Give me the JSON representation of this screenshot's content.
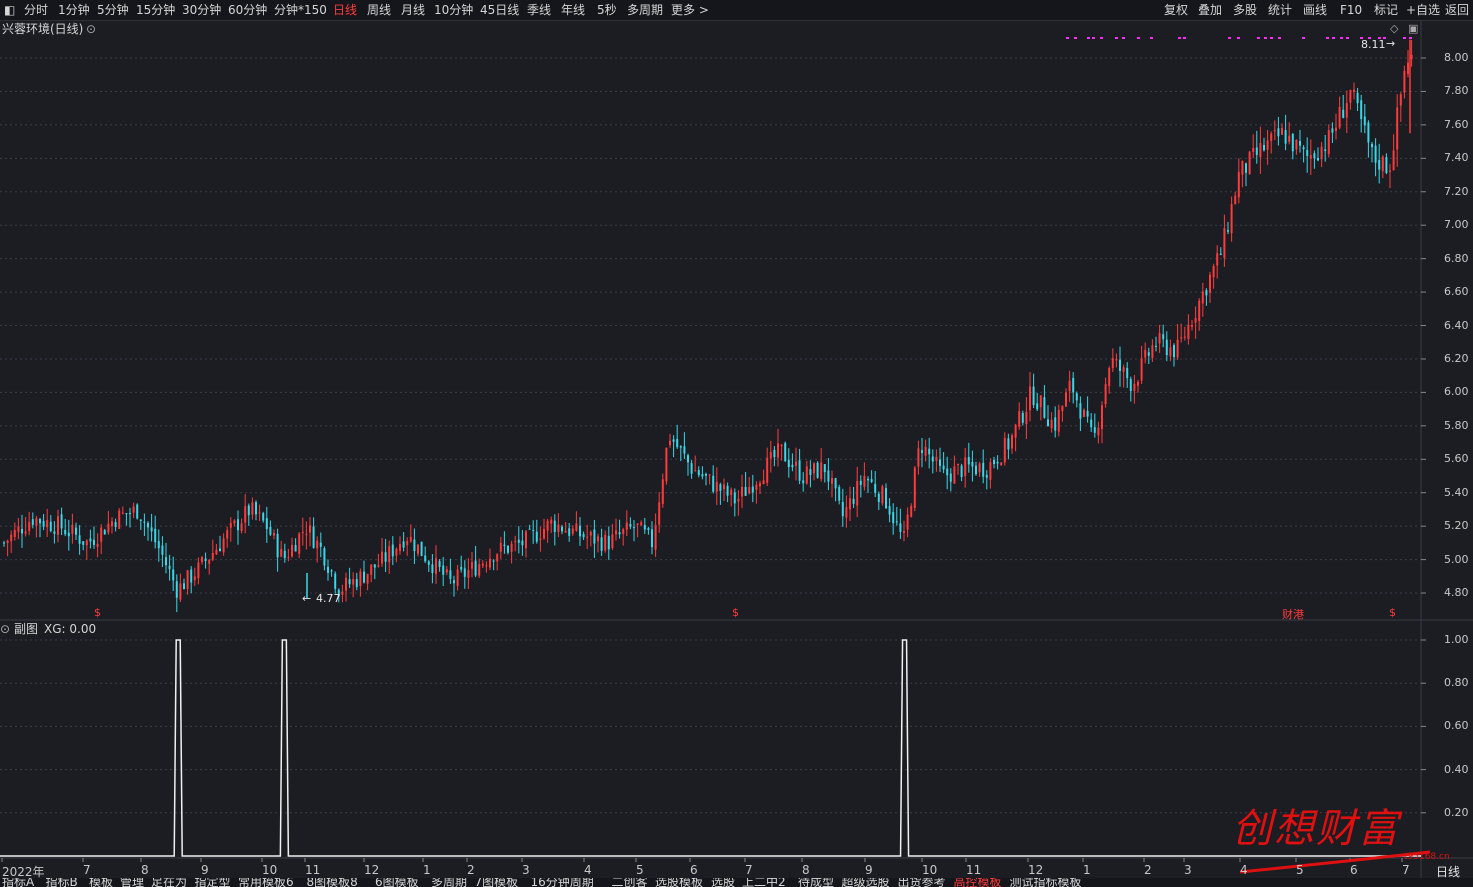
{
  "toolbar": {
    "left_items": [
      "分时",
      "1分钟",
      "5分钟",
      "15分钟",
      "30分钟",
      "60分钟",
      "分钟*150",
      "日线",
      "周线",
      "月线",
      "10分钟",
      "45日线",
      "季线",
      "年线",
      "5秒",
      "多周期",
      "更多 >"
    ],
    "active": "日线",
    "right_items": [
      "复权",
      "叠加",
      "多股",
      "统计",
      "画线",
      "F10",
      "标记",
      "+自选",
      "返回"
    ]
  },
  "main_chart": {
    "title": "兴蓉环境(日线)",
    "high_label": "8.11",
    "low_label": "4.77",
    "y_ticks": [
      "8.00",
      "7.80",
      "7.60",
      "7.40",
      "7.20",
      "7.00",
      "6.80",
      "6.60",
      "6.40",
      "6.20",
      "6.00",
      "5.80",
      "5.60",
      "5.40",
      "5.20",
      "5.00",
      "4.80"
    ],
    "event_marks": [
      "$",
      "$",
      "财港",
      "$"
    ]
  },
  "sub_chart": {
    "title": "副图",
    "indicator": "XG: 0.00",
    "y_ticks": [
      "1.00",
      "0.80",
      "0.60",
      "0.40",
      "0.20"
    ]
  },
  "x_axis": {
    "labels": [
      "2022年",
      "7",
      "8",
      "9",
      "10",
      "11",
      "12",
      "1",
      "2",
      "3",
      "4",
      "5",
      "6",
      "7",
      "8",
      "9",
      "10",
      "11",
      "12",
      "1",
      "2",
      "3",
      "4",
      "5",
      "6",
      "7"
    ],
    "period": "日线"
  },
  "bottom_tabs": {
    "items": [
      "指标A",
      "指标B",
      "模板",
      "管理",
      "足在为",
      "指定型",
      "常用模板6",
      "8图模板8",
      "6图模板",
      "多周期",
      "7图模板",
      "16分钟周期",
      "二创客",
      "选股模板",
      "选股",
      "上二中2",
      "待成型",
      "超级选股",
      "出货参考",
      "高控模板",
      "测试指标模板"
    ],
    "active": "高控模板"
  },
  "watermark": {
    "text": "创想财富",
    "url": "t95168.cn"
  },
  "colors": {
    "up": "#ff3b3b",
    "down": "#38d8e8",
    "signal": "#ff2bff",
    "accent_red": "#ff3b3b"
  },
  "chart_data": {
    "type": "candlestick",
    "price_range": [
      4.7,
      8.15
    ],
    "close_path": [
      [
        2022.42,
        5.1
      ],
      [
        2022.47,
        5.25
      ],
      [
        2022.52,
        5.2
      ],
      [
        2022.57,
        5.1
      ],
      [
        2022.62,
        5.25
      ],
      [
        2022.66,
        5.3
      ],
      [
        2022.7,
        5.05
      ],
      [
        2022.73,
        4.82
      ],
      [
        2022.77,
        4.95
      ],
      [
        2022.82,
        5.15
      ],
      [
        2022.86,
        5.3
      ],
      [
        2022.89,
        5.2
      ],
      [
        2022.92,
        5.0
      ],
      [
        2022.96,
        5.2
      ],
      [
        2022.99,
        5.05
      ],
      [
        2023.02,
        4.82
      ],
      [
        2023.06,
        4.9
      ],
      [
        2023.1,
        5.0
      ],
      [
        2023.14,
        5.15
      ],
      [
        2023.18,
        5.0
      ],
      [
        2023.22,
        4.86
      ],
      [
        2023.26,
        4.95
      ],
      [
        2023.3,
        5.05
      ],
      [
        2023.35,
        5.1
      ],
      [
        2023.4,
        5.22
      ],
      [
        2023.45,
        5.15
      ],
      [
        2023.5,
        5.1
      ],
      [
        2023.55,
        5.2
      ],
      [
        2023.58,
        5.1
      ],
      [
        2023.61,
        5.75
      ],
      [
        2023.65,
        5.55
      ],
      [
        2023.69,
        5.45
      ],
      [
        2023.73,
        5.35
      ],
      [
        2023.77,
        5.5
      ],
      [
        2023.81,
        5.65
      ],
      [
        2023.85,
        5.5
      ],
      [
        2023.89,
        5.55
      ],
      [
        2023.92,
        5.25
      ],
      [
        2023.96,
        5.5
      ],
      [
        2024.0,
        5.35
      ],
      [
        2024.03,
        5.1
      ],
      [
        2024.06,
        5.7
      ],
      [
        2024.1,
        5.5
      ],
      [
        2024.14,
        5.55
      ],
      [
        2024.18,
        5.55
      ],
      [
        2024.22,
        5.7
      ],
      [
        2024.26,
        6.0
      ],
      [
        2024.3,
        5.8
      ],
      [
        2024.33,
        6.05
      ],
      [
        2024.37,
        5.7
      ],
      [
        2024.4,
        6.2
      ],
      [
        2024.44,
        6.05
      ],
      [
        2024.48,
        6.3
      ],
      [
        2024.52,
        6.25
      ],
      [
        2024.56,
        6.55
      ],
      [
        2024.6,
        6.85
      ],
      [
        2024.63,
        7.3
      ],
      [
        2024.67,
        7.45
      ],
      [
        2024.71,
        7.55
      ],
      [
        2024.75,
        7.4
      ],
      [
        2024.79,
        7.5
      ],
      [
        2024.83,
        7.8
      ],
      [
        2024.87,
        7.4
      ],
      [
        2024.9,
        7.35
      ],
      [
        2024.93,
        8.0
      ]
    ],
    "highs_lows": {
      "high": 8.11,
      "low": 4.77
    },
    "sub_signal": {
      "name": "XG",
      "value": 0.0,
      "pulses": [
        2022.73,
        2022.92,
        2024.03
      ]
    }
  }
}
